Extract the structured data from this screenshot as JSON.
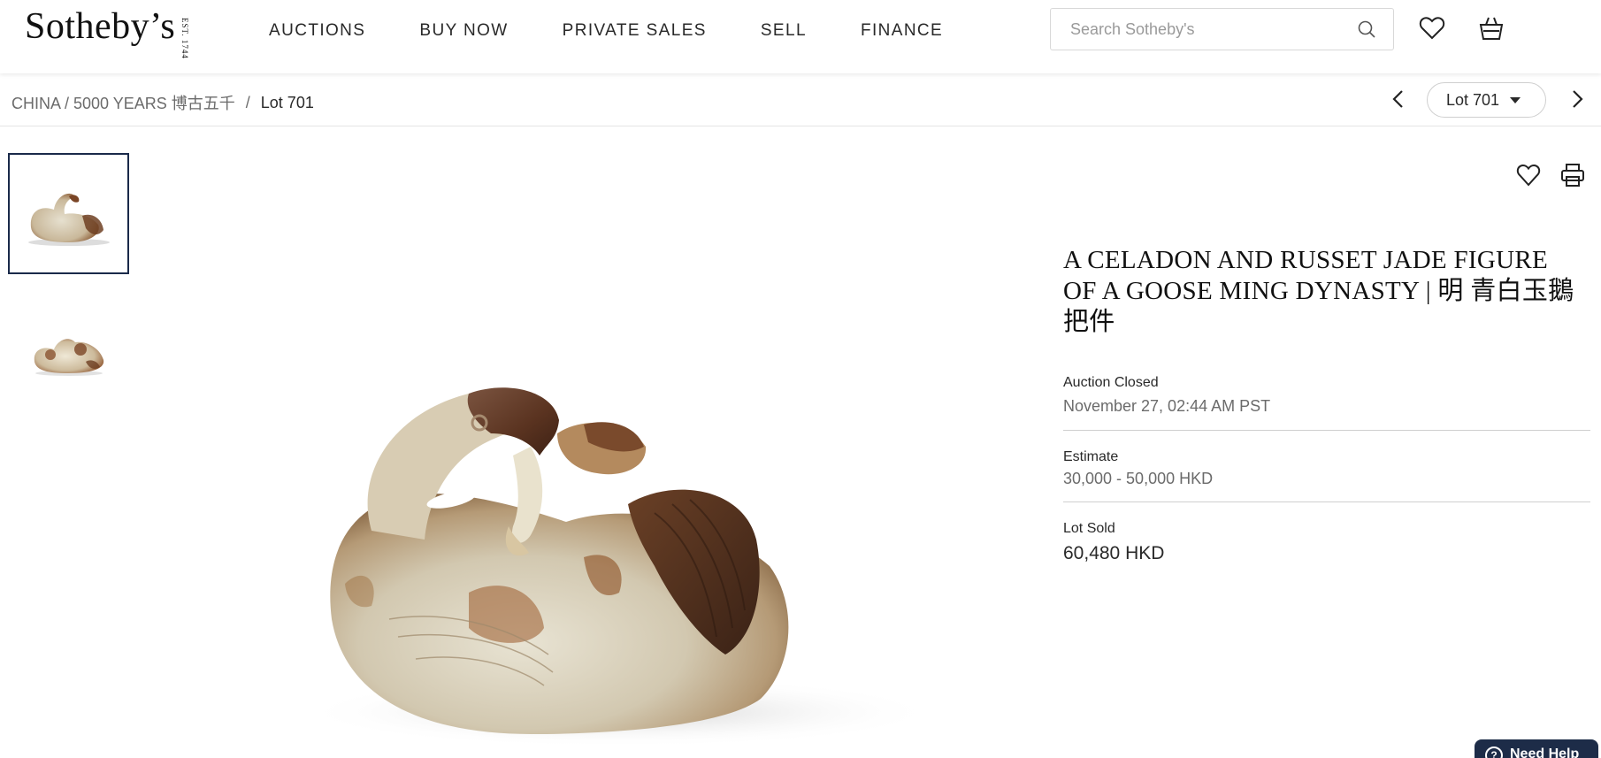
{
  "header": {
    "logo_text": "Sotheby’s",
    "logo_est": "EST. 1744",
    "nav": [
      "AUCTIONS",
      "BUY NOW",
      "PRIVATE SALES",
      "SELL",
      "FINANCE"
    ],
    "search_placeholder": "Search Sotheby's"
  },
  "breadcrumb": {
    "parent": "CHINA / 5000 YEARS 博古五千",
    "separator": "/",
    "current": "Lot 701"
  },
  "lot_nav": {
    "selected": "Lot 701"
  },
  "lot": {
    "title": "A CELADON AND RUSSET JADE FIGURE OF A GOOSE MING DYNASTY | 明 青白玉鵝把件",
    "status_label": "Auction Closed",
    "status_value": "November 27, 02:44 AM PST",
    "estimate_label": "Estimate",
    "estimate_value": "30,000 - 50,000 HKD",
    "sold_label": "Lot Sold",
    "sold_value": "60,480 HKD"
  },
  "help": {
    "label": "Need Help"
  },
  "colors": {
    "navy": "#1d2c48",
    "text": "#292929",
    "muted": "#6b6b6b"
  }
}
